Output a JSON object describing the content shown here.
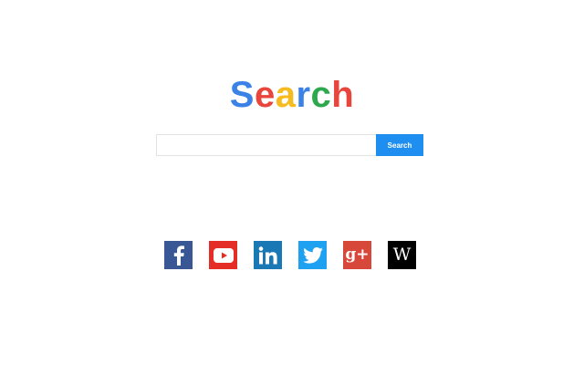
{
  "logo": {
    "letters": [
      {
        "char": "S",
        "color": "#3b82e6"
      },
      {
        "char": "e",
        "color": "#e8453c"
      },
      {
        "char": "a",
        "color": "#f6bb1e"
      },
      {
        "char": "r",
        "color": "#3b82e6"
      },
      {
        "char": "c",
        "color": "#2ea84f"
      },
      {
        "char": "h",
        "color": "#e8453c"
      }
    ]
  },
  "search": {
    "value": "",
    "placeholder": "",
    "button_label": "Search",
    "button_color": "#1e8ef0"
  },
  "social": [
    {
      "name": "facebook",
      "icon": "facebook-icon",
      "color": "#3a5795"
    },
    {
      "name": "youtube",
      "icon": "youtube-icon",
      "color": "#e52d27"
    },
    {
      "name": "linkedin",
      "icon": "linkedin-icon",
      "color": "#1a78b4"
    },
    {
      "name": "twitter",
      "icon": "twitter-icon",
      "color": "#1fa1f1"
    },
    {
      "name": "google-plus",
      "icon": "google-plus-icon",
      "color": "#d7473a",
      "glyph": "g+"
    },
    {
      "name": "wikipedia",
      "icon": "wikipedia-icon",
      "color": "#000000",
      "glyph": "W"
    }
  ]
}
